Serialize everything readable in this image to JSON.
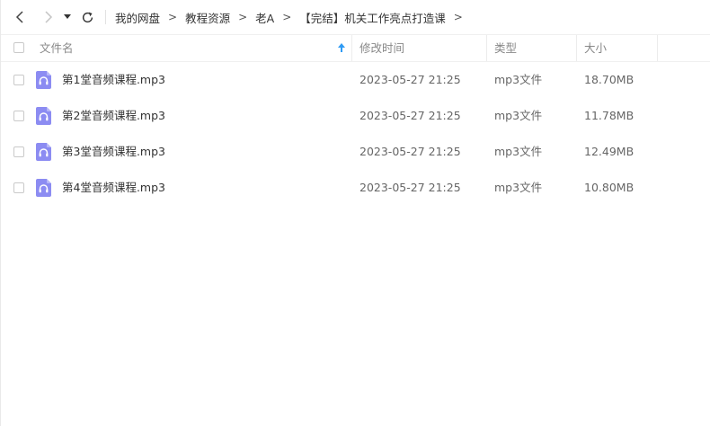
{
  "toolbar": {
    "breadcrumb": [
      "我的网盘",
      "教程资源",
      "老A",
      "【完结】机关工作亮点打造课"
    ],
    "separator": ">"
  },
  "columns": {
    "name": "文件名",
    "modified": "修改时间",
    "type": "类型",
    "size": "大小"
  },
  "files": [
    {
      "name": "第1堂音频课程.mp3",
      "modified": "2023-05-27 21:25",
      "type": "mp3文件",
      "size": "18.70MB"
    },
    {
      "name": "第2堂音频课程.mp3",
      "modified": "2023-05-27 21:25",
      "type": "mp3文件",
      "size": "11.78MB"
    },
    {
      "name": "第3堂音频课程.mp3",
      "modified": "2023-05-27 21:25",
      "type": "mp3文件",
      "size": "12.49MB"
    },
    {
      "name": "第4堂音频课程.mp3",
      "modified": "2023-05-27 21:25",
      "type": "mp3文件",
      "size": "10.80MB"
    }
  ],
  "icons": {
    "back": "back-arrow-icon",
    "forward": "forward-arrow-icon",
    "dropdown": "caret-down-icon",
    "refresh": "refresh-icon",
    "sort": "sort-ascending-icon",
    "file": "audio-file-icon"
  },
  "colors": {
    "audio_icon": "#8c8cf2",
    "sort_arrow": "#2f9bf4"
  }
}
